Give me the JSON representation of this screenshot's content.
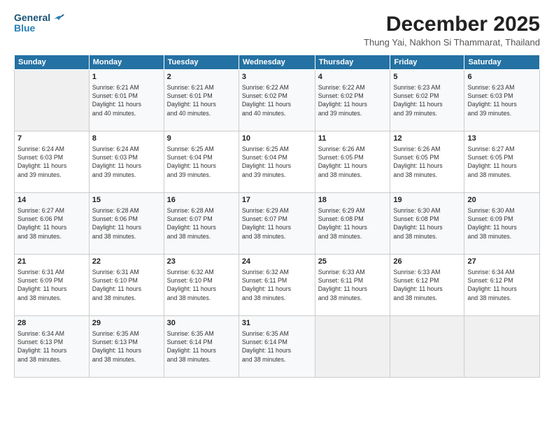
{
  "logo": {
    "line1": "General",
    "line2": "Blue"
  },
  "title": "December 2025",
  "subtitle": "Thung Yai, Nakhon Si Thammarat, Thailand",
  "header_days": [
    "Sunday",
    "Monday",
    "Tuesday",
    "Wednesday",
    "Thursday",
    "Friday",
    "Saturday"
  ],
  "weeks": [
    [
      {
        "day": "",
        "info": ""
      },
      {
        "day": "1",
        "info": "Sunrise: 6:21 AM\nSunset: 6:01 PM\nDaylight: 11 hours\nand 40 minutes."
      },
      {
        "day": "2",
        "info": "Sunrise: 6:21 AM\nSunset: 6:01 PM\nDaylight: 11 hours\nand 40 minutes."
      },
      {
        "day": "3",
        "info": "Sunrise: 6:22 AM\nSunset: 6:02 PM\nDaylight: 11 hours\nand 40 minutes."
      },
      {
        "day": "4",
        "info": "Sunrise: 6:22 AM\nSunset: 6:02 PM\nDaylight: 11 hours\nand 39 minutes."
      },
      {
        "day": "5",
        "info": "Sunrise: 6:23 AM\nSunset: 6:02 PM\nDaylight: 11 hours\nand 39 minutes."
      },
      {
        "day": "6",
        "info": "Sunrise: 6:23 AM\nSunset: 6:03 PM\nDaylight: 11 hours\nand 39 minutes."
      }
    ],
    [
      {
        "day": "7",
        "info": "Sunrise: 6:24 AM\nSunset: 6:03 PM\nDaylight: 11 hours\nand 39 minutes."
      },
      {
        "day": "8",
        "info": "Sunrise: 6:24 AM\nSunset: 6:03 PM\nDaylight: 11 hours\nand 39 minutes."
      },
      {
        "day": "9",
        "info": "Sunrise: 6:25 AM\nSunset: 6:04 PM\nDaylight: 11 hours\nand 39 minutes."
      },
      {
        "day": "10",
        "info": "Sunrise: 6:25 AM\nSunset: 6:04 PM\nDaylight: 11 hours\nand 39 minutes."
      },
      {
        "day": "11",
        "info": "Sunrise: 6:26 AM\nSunset: 6:05 PM\nDaylight: 11 hours\nand 38 minutes."
      },
      {
        "day": "12",
        "info": "Sunrise: 6:26 AM\nSunset: 6:05 PM\nDaylight: 11 hours\nand 38 minutes."
      },
      {
        "day": "13",
        "info": "Sunrise: 6:27 AM\nSunset: 6:05 PM\nDaylight: 11 hours\nand 38 minutes."
      }
    ],
    [
      {
        "day": "14",
        "info": "Sunrise: 6:27 AM\nSunset: 6:06 PM\nDaylight: 11 hours\nand 38 minutes."
      },
      {
        "day": "15",
        "info": "Sunrise: 6:28 AM\nSunset: 6:06 PM\nDaylight: 11 hours\nand 38 minutes."
      },
      {
        "day": "16",
        "info": "Sunrise: 6:28 AM\nSunset: 6:07 PM\nDaylight: 11 hours\nand 38 minutes."
      },
      {
        "day": "17",
        "info": "Sunrise: 6:29 AM\nSunset: 6:07 PM\nDaylight: 11 hours\nand 38 minutes."
      },
      {
        "day": "18",
        "info": "Sunrise: 6:29 AM\nSunset: 6:08 PM\nDaylight: 11 hours\nand 38 minutes."
      },
      {
        "day": "19",
        "info": "Sunrise: 6:30 AM\nSunset: 6:08 PM\nDaylight: 11 hours\nand 38 minutes."
      },
      {
        "day": "20",
        "info": "Sunrise: 6:30 AM\nSunset: 6:09 PM\nDaylight: 11 hours\nand 38 minutes."
      }
    ],
    [
      {
        "day": "21",
        "info": "Sunrise: 6:31 AM\nSunset: 6:09 PM\nDaylight: 11 hours\nand 38 minutes."
      },
      {
        "day": "22",
        "info": "Sunrise: 6:31 AM\nSunset: 6:10 PM\nDaylight: 11 hours\nand 38 minutes."
      },
      {
        "day": "23",
        "info": "Sunrise: 6:32 AM\nSunset: 6:10 PM\nDaylight: 11 hours\nand 38 minutes."
      },
      {
        "day": "24",
        "info": "Sunrise: 6:32 AM\nSunset: 6:11 PM\nDaylight: 11 hours\nand 38 minutes."
      },
      {
        "day": "25",
        "info": "Sunrise: 6:33 AM\nSunset: 6:11 PM\nDaylight: 11 hours\nand 38 minutes."
      },
      {
        "day": "26",
        "info": "Sunrise: 6:33 AM\nSunset: 6:12 PM\nDaylight: 11 hours\nand 38 minutes."
      },
      {
        "day": "27",
        "info": "Sunrise: 6:34 AM\nSunset: 6:12 PM\nDaylight: 11 hours\nand 38 minutes."
      }
    ],
    [
      {
        "day": "28",
        "info": "Sunrise: 6:34 AM\nSunset: 6:13 PM\nDaylight: 11 hours\nand 38 minutes."
      },
      {
        "day": "29",
        "info": "Sunrise: 6:35 AM\nSunset: 6:13 PM\nDaylight: 11 hours\nand 38 minutes."
      },
      {
        "day": "30",
        "info": "Sunrise: 6:35 AM\nSunset: 6:14 PM\nDaylight: 11 hours\nand 38 minutes."
      },
      {
        "day": "31",
        "info": "Sunrise: 6:35 AM\nSunset: 6:14 PM\nDaylight: 11 hours\nand 38 minutes."
      },
      {
        "day": "",
        "info": ""
      },
      {
        "day": "",
        "info": ""
      },
      {
        "day": "",
        "info": ""
      }
    ]
  ]
}
